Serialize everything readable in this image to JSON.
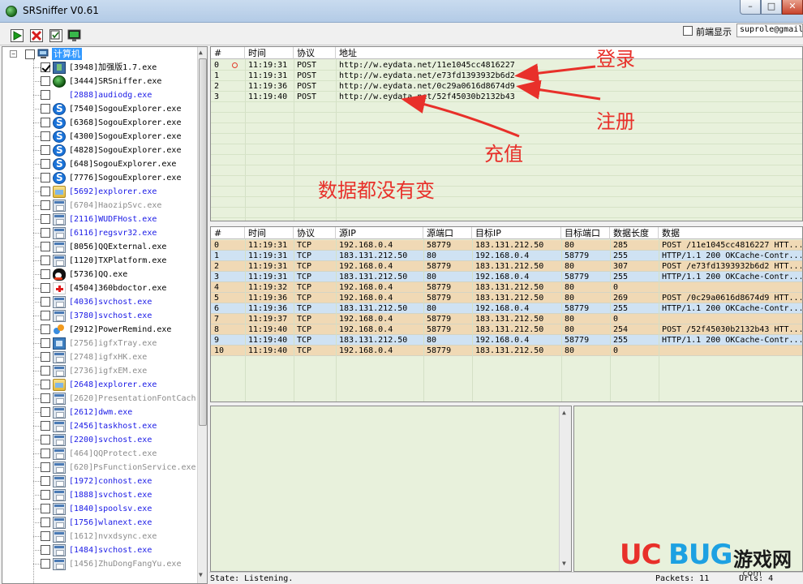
{
  "window": {
    "title": "SRSniffer V0.61"
  },
  "toolbar": {
    "buttons": [
      "start-capture",
      "stop-capture",
      "filter",
      "export"
    ]
  },
  "front_display": {
    "label": "前端显示",
    "filter_value": "suprole@gmail",
    "checked": false
  },
  "tree": {
    "root_label": "计算机",
    "processes": [
      {
        "name": "[3948]加强版1.7.exe",
        "style": "normal",
        "icon": "sr-icon",
        "checked": true
      },
      {
        "name": "[3444]SRSniffer.exe",
        "style": "normal",
        "icon": "globe-icon",
        "checked": false
      },
      {
        "name": "[2888]audiodg.exe",
        "style": "blue",
        "icon": "",
        "checked": false
      },
      {
        "name": "[7540]SogouExplorer.exe",
        "style": "normal",
        "icon": "sogou-icon",
        "checked": false
      },
      {
        "name": "[6368]SogouExplorer.exe",
        "style": "normal",
        "icon": "sogou-icon",
        "checked": false
      },
      {
        "name": "[4300]SogouExplorer.exe",
        "style": "normal",
        "icon": "sogou-icon",
        "checked": false
      },
      {
        "name": "[4828]SogouExplorer.exe",
        "style": "normal",
        "icon": "sogou-icon",
        "checked": false
      },
      {
        "name": "[648]SogouExplorer.exe",
        "style": "normal",
        "icon": "sogou-icon",
        "checked": false
      },
      {
        "name": "[7776]SogouExplorer.exe",
        "style": "normal",
        "icon": "sogou-icon",
        "checked": false
      },
      {
        "name": "[5692]explorer.exe",
        "style": "blue",
        "icon": "folder-icon",
        "checked": false
      },
      {
        "name": "[6704]HaozipSvc.exe",
        "style": "gray",
        "icon": "window-icon",
        "checked": false
      },
      {
        "name": "[2116]WUDFHost.exe",
        "style": "blue",
        "icon": "window-icon",
        "checked": false
      },
      {
        "name": "[6116]regsvr32.exe",
        "style": "blue",
        "icon": "window-icon",
        "checked": false
      },
      {
        "name": "[8056]QQExternal.exe",
        "style": "normal",
        "icon": "window-icon",
        "checked": false
      },
      {
        "name": "[1120]TXPlatform.exe",
        "style": "normal",
        "icon": "window-icon",
        "checked": false
      },
      {
        "name": "[5736]QQ.exe",
        "style": "normal",
        "icon": "penguin-icon",
        "checked": false
      },
      {
        "name": "[4504]360bdoctor.exe",
        "style": "normal",
        "icon": "doctor-icon",
        "checked": false
      },
      {
        "name": "[4036]svchost.exe",
        "style": "blue",
        "icon": "window-icon",
        "checked": false
      },
      {
        "name": "[3780]svchost.exe",
        "style": "blue",
        "icon": "window-icon",
        "checked": false
      },
      {
        "name": "[2912]PowerRemind.exe",
        "style": "normal",
        "icon": "power-icon",
        "checked": false
      },
      {
        "name": "[2756]igfxTray.exe",
        "style": "gray",
        "icon": "tray-icon",
        "checked": false
      },
      {
        "name": "[2748]igfxHK.exe",
        "style": "gray",
        "icon": "window-icon",
        "checked": false
      },
      {
        "name": "[2736]igfxEM.exe",
        "style": "gray",
        "icon": "window-icon",
        "checked": false
      },
      {
        "name": "[2648]explorer.exe",
        "style": "blue",
        "icon": "folder-icon",
        "checked": false
      },
      {
        "name": "[2620]PresentationFontCach",
        "style": "gray",
        "icon": "window-icon",
        "checked": false
      },
      {
        "name": "[2612]dwm.exe",
        "style": "blue",
        "icon": "window-icon",
        "checked": false
      },
      {
        "name": "[2456]taskhost.exe",
        "style": "blue",
        "icon": "window-icon",
        "checked": false
      },
      {
        "name": "[2200]svchost.exe",
        "style": "blue",
        "icon": "window-icon",
        "checked": false
      },
      {
        "name": "[464]QQProtect.exe",
        "style": "gray",
        "icon": "window-icon",
        "checked": false
      },
      {
        "name": "[620]PsFunctionService.exe",
        "style": "gray",
        "icon": "window-icon",
        "checked": false
      },
      {
        "name": "[1972]conhost.exe",
        "style": "blue",
        "icon": "window-icon",
        "checked": false
      },
      {
        "name": "[1888]svchost.exe",
        "style": "blue",
        "icon": "window-icon",
        "checked": false
      },
      {
        "name": "[1840]spoolsv.exe",
        "style": "blue",
        "icon": "window-icon",
        "checked": false
      },
      {
        "name": "[1756]wlanext.exe",
        "style": "blue",
        "icon": "window-icon",
        "checked": false
      },
      {
        "name": "[1612]nvxdsync.exe",
        "style": "gray",
        "icon": "window-icon",
        "checked": false
      },
      {
        "name": "[1484]svchost.exe",
        "style": "blue",
        "icon": "window-icon",
        "checked": false
      },
      {
        "name": "[1456]ZhuDongFangYu.exe",
        "style": "gray",
        "icon": "window-icon",
        "checked": false
      }
    ]
  },
  "url_table": {
    "headers": [
      "#",
      "时间",
      "协议",
      "地址"
    ],
    "rows": [
      {
        "id": "0",
        "time": "11:19:31",
        "protocol": "POST",
        "address": "http://w.eydata.net/11e1045cc4816227",
        "marked": true
      },
      {
        "id": "1",
        "time": "11:19:31",
        "protocol": "POST",
        "address": "http://w.eydata.net/e73fd1393932b6d2",
        "marked": false
      },
      {
        "id": "2",
        "time": "11:19:36",
        "protocol": "POST",
        "address": "http://w.eydata.net/0c29a0616d8674d9",
        "marked": false
      },
      {
        "id": "3",
        "time": "11:19:40",
        "protocol": "POST",
        "address": "http://w.eydata.net/52f45030b2132b43",
        "marked": false
      }
    ]
  },
  "packet_table": {
    "headers": [
      "#",
      "时间",
      "协议",
      "源IP",
      "源端口",
      "目标IP",
      "目标端口",
      "数据长度",
      "数据"
    ],
    "rows": [
      {
        "id": "0",
        "time": "11:19:31",
        "protocol": "TCP",
        "src_ip": "192.168.0.4",
        "src_port": "58779",
        "dst_ip": "183.131.212.50",
        "dst_port": "80",
        "length": "285",
        "data": "POST /11e1045cc4816227 HTT...",
        "direction": "out"
      },
      {
        "id": "1",
        "time": "11:19:31",
        "protocol": "TCP",
        "src_ip": "183.131.212.50",
        "src_port": "80",
        "dst_ip": "192.168.0.4",
        "dst_port": "58779",
        "length": "255",
        "data": "HTTP/1.1 200 OKCache-Contr...",
        "direction": "in"
      },
      {
        "id": "2",
        "time": "11:19:31",
        "protocol": "TCP",
        "src_ip": "192.168.0.4",
        "src_port": "58779",
        "dst_ip": "183.131.212.50",
        "dst_port": "80",
        "length": "307",
        "data": "POST /e73fd1393932b6d2 HTT...",
        "direction": "out"
      },
      {
        "id": "3",
        "time": "11:19:31",
        "protocol": "TCP",
        "src_ip": "183.131.212.50",
        "src_port": "80",
        "dst_ip": "192.168.0.4",
        "dst_port": "58779",
        "length": "255",
        "data": "HTTP/1.1 200 OKCache-Contr...",
        "direction": "in"
      },
      {
        "id": "4",
        "time": "11:19:32",
        "protocol": "TCP",
        "src_ip": "192.168.0.4",
        "src_port": "58779",
        "dst_ip": "183.131.212.50",
        "dst_port": "80",
        "length": "0",
        "data": "",
        "direction": "out"
      },
      {
        "id": "5",
        "time": "11:19:36",
        "protocol": "TCP",
        "src_ip": "192.168.0.4",
        "src_port": "58779",
        "dst_ip": "183.131.212.50",
        "dst_port": "80",
        "length": "269",
        "data": "POST /0c29a0616d8674d9 HTT...",
        "direction": "out"
      },
      {
        "id": "6",
        "time": "11:19:36",
        "protocol": "TCP",
        "src_ip": "183.131.212.50",
        "src_port": "80",
        "dst_ip": "192.168.0.4",
        "dst_port": "58779",
        "length": "255",
        "data": "HTTP/1.1 200 OKCache-Contr...",
        "direction": "in"
      },
      {
        "id": "7",
        "time": "11:19:37",
        "protocol": "TCP",
        "src_ip": "192.168.0.4",
        "src_port": "58779",
        "dst_ip": "183.131.212.50",
        "dst_port": "80",
        "length": "0",
        "data": "",
        "direction": "out"
      },
      {
        "id": "8",
        "time": "11:19:40",
        "protocol": "TCP",
        "src_ip": "192.168.0.4",
        "src_port": "58779",
        "dst_ip": "183.131.212.50",
        "dst_port": "80",
        "length": "254",
        "data": "POST /52f45030b2132b43 HTT...",
        "direction": "out"
      },
      {
        "id": "9",
        "time": "11:19:40",
        "protocol": "TCP",
        "src_ip": "183.131.212.50",
        "src_port": "80",
        "dst_ip": "192.168.0.4",
        "dst_port": "58779",
        "length": "255",
        "data": "HTTP/1.1 200 OKCache-Contr...",
        "direction": "in"
      },
      {
        "id": "10",
        "time": "11:19:40",
        "protocol": "TCP",
        "src_ip": "192.168.0.4",
        "src_port": "58779",
        "dst_ip": "183.131.212.50",
        "dst_port": "80",
        "length": "0",
        "data": "",
        "direction": "out"
      }
    ]
  },
  "status": {
    "state": "State: Listening.",
    "packets": "Packets: 11",
    "urls": "Urls: 4"
  },
  "annotations": {
    "login": "登录",
    "register": "注册",
    "recharge": "充值",
    "unchanged": "数据都没有变"
  },
  "watermark": {
    "brand_red": "UC",
    "brand_blue": "BUG",
    "brand_cn": "游戏网",
    "domain": ".com"
  },
  "colors": {
    "panel_bg": "#e8f1dc",
    "row_out": "#f0d9b5",
    "row_in": "#cfe2f3",
    "annotation": "#e8302a",
    "link_blue": "#1a1ae6",
    "inactive_gray": "#8c8c8c"
  }
}
